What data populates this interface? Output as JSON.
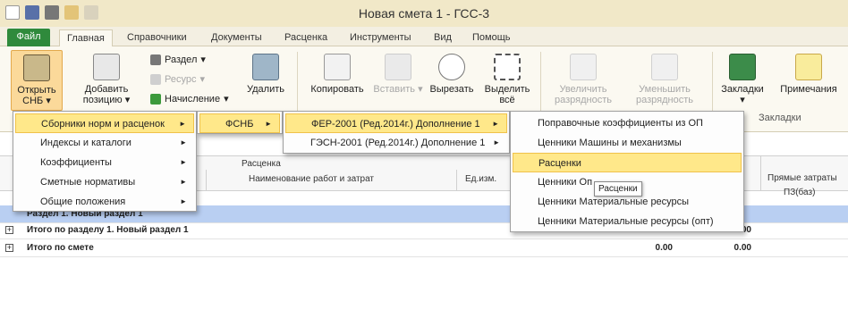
{
  "window": {
    "title": "Новая смета 1 - ГСС-3"
  },
  "tabs": [
    {
      "label": "Файл"
    },
    {
      "label": "Главная"
    },
    {
      "label": "Справочники"
    },
    {
      "label": "Документы"
    },
    {
      "label": "Расценка"
    },
    {
      "label": "Инструменты"
    },
    {
      "label": "Вид"
    },
    {
      "label": "Помощь"
    }
  ],
  "ribbon": {
    "open_snb": "Открыть СНБ",
    "open_snb_arrow": "▾",
    "add_position_1": "Добавить",
    "add_position_2": "позицию",
    "add_position_arrow": "▾",
    "section": "Раздел",
    "resource": "Ресурс",
    "accrual": "Начисление",
    "delete": "Удалить",
    "copy": "Копировать",
    "paste": "Вставить",
    "cut": "Вырезать",
    "select_all_1": "Выделить",
    "select_all_2": "всё",
    "increase_1": "Увеличить",
    "increase_2": "разрядность",
    "decrease_1": "Уменьшить",
    "decrease_2": "разрядность",
    "bookmarks": "Закладки",
    "bookmarks_arrow": "▾",
    "notes": "Примечания",
    "bookmarks_group": "Закладки"
  },
  "table": {
    "col_rascenka": "Расценка",
    "col_name": "Наименование работ и затрат",
    "col_unit": "Ед.изм.",
    "col_direct": "Прямые затраты",
    "col_pz": "ПЗ(баз)",
    "rows": [
      {
        "label": "Раздел 1. Новый раздел 1",
        "v1": "",
        "v2": ""
      },
      {
        "label": "Итого по разделу 1. Новый раздел 1",
        "v1": "0.00",
        "v2": "0.00"
      },
      {
        "label": "Итого по смете",
        "v1": "0.00",
        "v2": "0.00"
      }
    ]
  },
  "menu1": [
    {
      "label": "Сборники норм и расценок",
      "arrow": "►"
    },
    {
      "label": "Индексы и каталоги",
      "arrow": "►"
    },
    {
      "label": "Коэффициенты",
      "arrow": "►"
    },
    {
      "label": "Сметные нормативы",
      "arrow": "►"
    },
    {
      "label": "Общие положения",
      "arrow": "►"
    }
  ],
  "menu2": [
    {
      "label": "ФСНБ",
      "arrow": "►"
    }
  ],
  "menu3": [
    {
      "label": "ФЕР-2001 (Ред.2014г.) Дополнение 1",
      "arrow": "►"
    },
    {
      "label": "ГЭСН-2001 (Ред.2014г.) Дополнение 1",
      "arrow": "►"
    }
  ],
  "menu4": [
    {
      "label": "Поправочные коэффициенты из ОП"
    },
    {
      "label": "Ценники Машины и механизмы"
    },
    {
      "label": "Расценки"
    },
    {
      "label": "Ценники Оп"
    },
    {
      "label": "Ценники Материальные ресурсы"
    },
    {
      "label": "Ценники Материальные ресурсы (опт)"
    }
  ],
  "tooltip": "Расценки"
}
